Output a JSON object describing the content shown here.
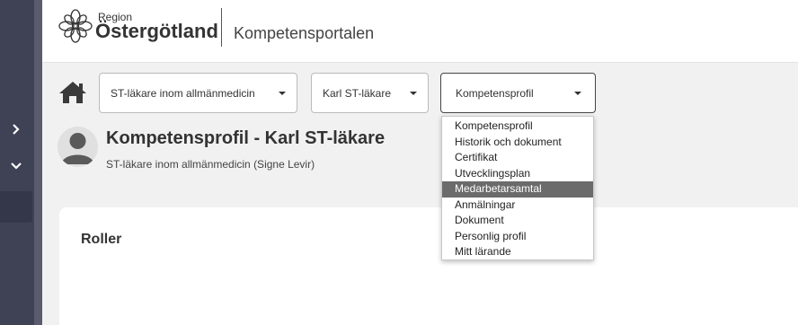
{
  "header": {
    "logo_region": "Region",
    "logo_name": "Östergötland",
    "portal_title": "Kompetensportalen"
  },
  "sidebar": {
    "expand_icon": "chevron-right-icon",
    "collapse_icon": "chevron-down-icon"
  },
  "toolbar": {
    "home_icon": "home-icon",
    "role_select": "ST-läkare inom allmänmedicin",
    "person_select": "Karl ST-läkare",
    "page_select": "Kompetensprofil"
  },
  "profile": {
    "title": "Kompetensprofil - Karl ST-läkare",
    "subtitle": "ST-läkare inom allmänmedicin (Signe Levir)"
  },
  "card": {
    "title": "Roller"
  },
  "menu": {
    "items": [
      "Kompetensprofil",
      "Historik och dokument",
      "Certifikat",
      "Utvecklingsplan",
      "Medarbetarsamtal",
      "Anmälningar",
      "Dokument",
      "Personlig profil",
      "Mitt lärande"
    ],
    "highlighted": "Medarbetarsamtal"
  }
}
